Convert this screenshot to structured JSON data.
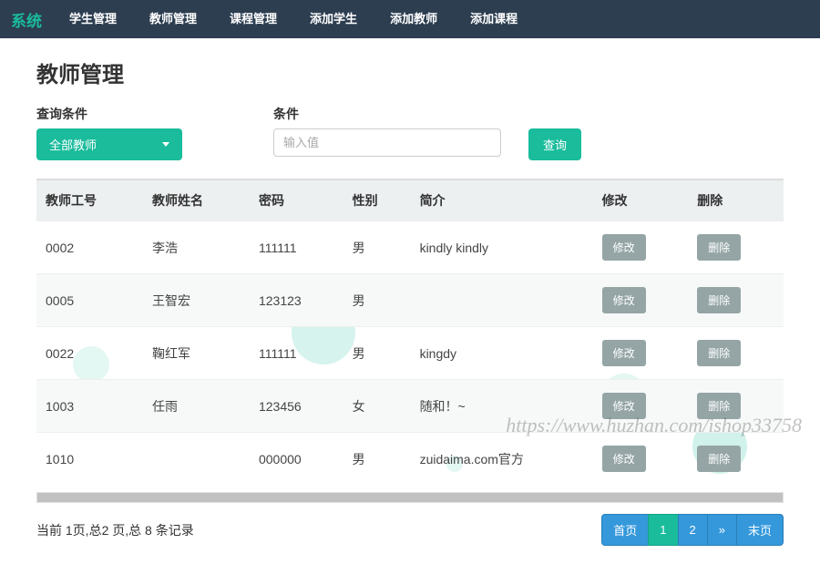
{
  "nav": {
    "brand": "系统",
    "items": [
      "学生管理",
      "教师管理",
      "课程管理",
      "添加学生",
      "添加教师",
      "添加课程"
    ]
  },
  "page": {
    "title": "教师管理"
  },
  "filter": {
    "query_label": "查询条件",
    "dropdown_value": "全部教师",
    "cond_label": "条件",
    "input_placeholder": "输入值",
    "search_btn": "查询"
  },
  "table": {
    "headers": [
      "教师工号",
      "教师姓名",
      "密码",
      "性别",
      "简介",
      "修改",
      "删除"
    ],
    "edit_btn": "修改",
    "delete_btn": "删除",
    "rows": [
      {
        "id": "0002",
        "name": "李浩",
        "pwd": "111111",
        "gender": "男",
        "bio": "kindly kindly"
      },
      {
        "id": "0005",
        "name": "王智宏",
        "pwd": "123123",
        "gender": "男",
        "bio": ""
      },
      {
        "id": "0022",
        "name": "鞠红军",
        "pwd": "111111",
        "gender": "男",
        "bio": "kingdy"
      },
      {
        "id": "1003",
        "name": "任雨",
        "pwd": "123456",
        "gender": "女",
        "bio": "随和！~"
      },
      {
        "id": "1010",
        "name": "",
        "pwd": "000000",
        "gender": "男",
        "bio": "zuidaima.com官方"
      }
    ]
  },
  "pagination": {
    "info": "当前 1页,总2 页,总 8 条记录",
    "first": "首页",
    "pages": [
      "1",
      "2"
    ],
    "next_symbol": "»",
    "last": "末页",
    "current": 1
  },
  "watermark": "https://www.huzhan.com/ishop33758"
}
